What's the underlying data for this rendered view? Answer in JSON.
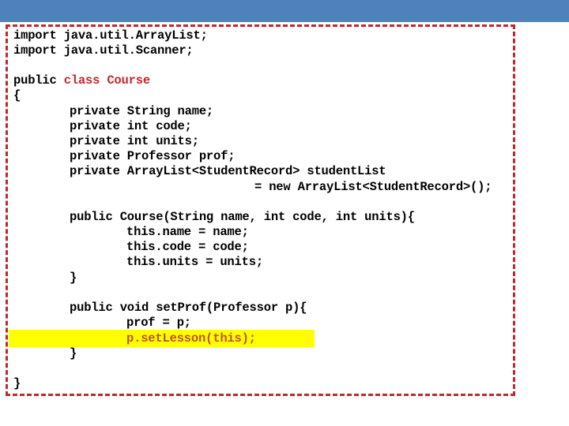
{
  "slide": {
    "header_color": "#4f81bd",
    "frame_color": "#c0282d",
    "highlight_color": "#ffff00"
  },
  "code": {
    "import_1": "import java.util.ArrayList;",
    "import_2": "import java.util.Scanner;",
    "class_public": "public ",
    "class_decl": "class Course",
    "open_brace": "{",
    "field_1": "private String name;",
    "field_2": "private int code;",
    "field_3": "private int units;",
    "field_4": "private Professor prof;",
    "field_5": "private ArrayList<StudentRecord> studentList",
    "field_5_cont": "= new ArrayList<StudentRecord>();",
    "ctor_sig": "public Course(String name, int code, int units){",
    "ctor_line_1": "this.name = name;",
    "ctor_line_2": "this.code = code;",
    "ctor_line_3": "this.units = units;",
    "ctor_close": "}",
    "method_sig": "public void setProf(Professor p){",
    "method_line_1": "prof = p;",
    "method_line_2": "p.setLesson(this);",
    "method_close": "}",
    "class_close": "}"
  }
}
